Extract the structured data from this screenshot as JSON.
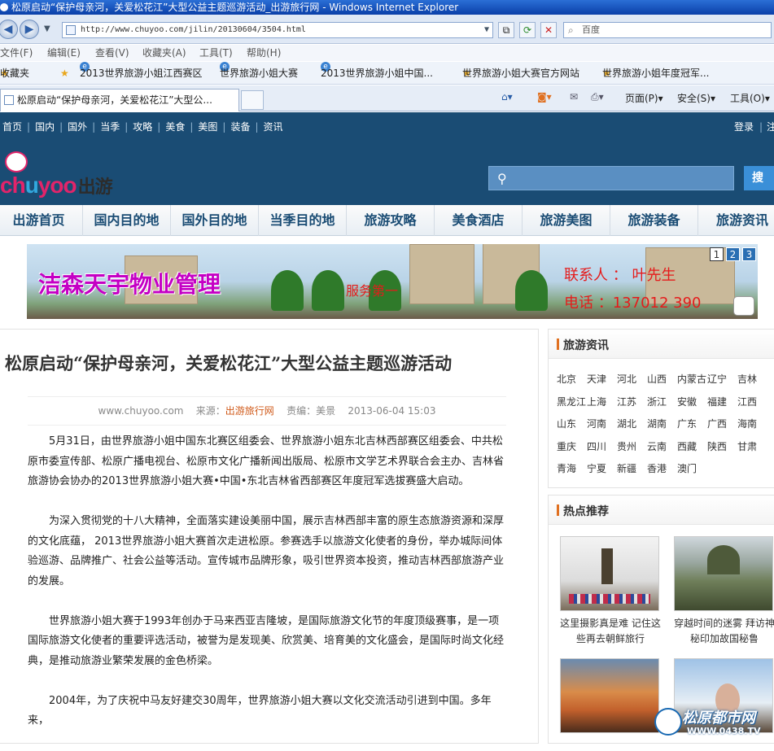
{
  "window": {
    "title": "松原启动“保护母亲河，关爱松花江”大型公益主题巡游活动_出游旅行网 - Windows Internet Explorer"
  },
  "address": {
    "url": "http://www.chuyoo.com/jilin/20130604/3504.html",
    "search_placeholder": "百度"
  },
  "menu": [
    "文件(F)",
    "编辑(E)",
    "查看(V)",
    "收藏夹(A)",
    "工具(T)",
    "帮助(H)"
  ],
  "favorites": {
    "label": "收藏夹",
    "items": [
      "2013世界旅游小姐江西赛区",
      "世界旅游小姐大赛",
      "2013世界旅游小姐中国...",
      "世界旅游小姐大赛官方网站",
      "世界旅游小姐年度冠军..."
    ]
  },
  "tab": {
    "title": "松原启动“保护母亲河，关爱松花江”大型公...",
    "tools": [
      "页面(P)",
      "安全(S)",
      "工具(O)"
    ]
  },
  "site": {
    "toplinks": [
      "首页",
      "国内",
      "国外",
      "当季",
      "攻略",
      "美食",
      "美图",
      "装备",
      "资讯"
    ],
    "login": "登录",
    "register": "注",
    "logo_latin": "chuyoo",
    "logo_cn": "出游",
    "search_button": "搜",
    "nav": [
      "出游首页",
      "国内目的地",
      "国外目的地",
      "当季目的地",
      "旅游攻略",
      "美食酒店",
      "旅游美图",
      "旅游装备",
      "旅游资讯"
    ]
  },
  "banner": {
    "company": "洁森天宇物业管理",
    "service": "服务第一",
    "contact": "联系人 ： 叶先生",
    "phone": "电话 ：137012   390",
    "pages": [
      "1",
      "2",
      "3"
    ]
  },
  "article": {
    "title": "松原启动“保护母亲河，关爱松花江”大型公益主题巡游活动",
    "site": "www.chuyoo.com",
    "source_label": "来源：",
    "source": "出游旅行网",
    "editor": "责编：美景",
    "date": "2013-06-04 15:03",
    "paragraphs": [
      "5月31日，由世界旅游小姐中国东北赛区组委会、世界旅游小姐东北吉林西部赛区组委会、中共松原市委宣传部、松原广播电视台、松原市文化广播新闻出版局、松原市文学艺术界联合会主办、吉林省旅游协会协办的2013世界旅游小姐大赛•中国•东北吉林省西部赛区年度冠军选拔赛盛大启动。",
      "为深入贯彻党的十八大精神，全面落实建设美丽中国，展示吉林西部丰富的原生态旅游资源和深厚的文化底蕴， 2013世界旅游小姐大赛首次走进松原。参赛选手以旅游文化使者的身份，举办城际间体验巡游、品牌推广、社会公益等活动。宣传城市品牌形象，吸引世界资本投资，推动吉林西部旅游产业的发展。",
      "世界旅游小姐大赛于1993年创办于马来西亚吉隆坡，是国际旅游文化节的年度顶级赛事，是一项国际旅游文化使者的重要评选活动，被誉为是发现美、欣赏美、培育美的文化盛会，是国际时尚文化经典，是推动旅游业繁荣发展的金色桥梁。",
      "2004年，为了庆祝中马友好建交30周年，世界旅游小姐大赛以文化交流活动引进到中国。多年来，"
    ]
  },
  "sidebar": {
    "news_title": "旅游资讯",
    "regions": [
      "北京",
      "天津",
      "河北",
      "山西",
      "内蒙古",
      "辽宁",
      "吉林",
      "黑龙江",
      "上海",
      "江苏",
      "浙江",
      "安徽",
      "福建",
      "江西",
      "山东",
      "河南",
      "湖北",
      "湖南",
      "广东",
      "广西",
      "海南",
      "重庆",
      "四川",
      "贵州",
      "云南",
      "西藏",
      "陕西",
      "甘肃",
      "青海",
      "宁夏",
      "新疆",
      "香港",
      "澳门"
    ],
    "hot_title": "热点推荐",
    "hot": [
      {
        "cap1": "这里摄影真是难 记住这",
        "cap2": "些再去朝鲜旅行"
      },
      {
        "cap1": "穿越时间的迷雾 拜访神",
        "cap2": "秘印加故国秘鲁"
      },
      {
        "cap1": "",
        "cap2": ""
      },
      {
        "cap1": "",
        "cap2": ""
      }
    ]
  },
  "watermark": {
    "name": "松原都市网",
    "domain": "WWW.0438.TV"
  },
  "colors": {
    "site_header": "#1a4c74",
    "nav_text": "#1a4c74",
    "accent": "#e07020",
    "banner_text": "#c400c4",
    "banner_red": "#e51b1b"
  }
}
